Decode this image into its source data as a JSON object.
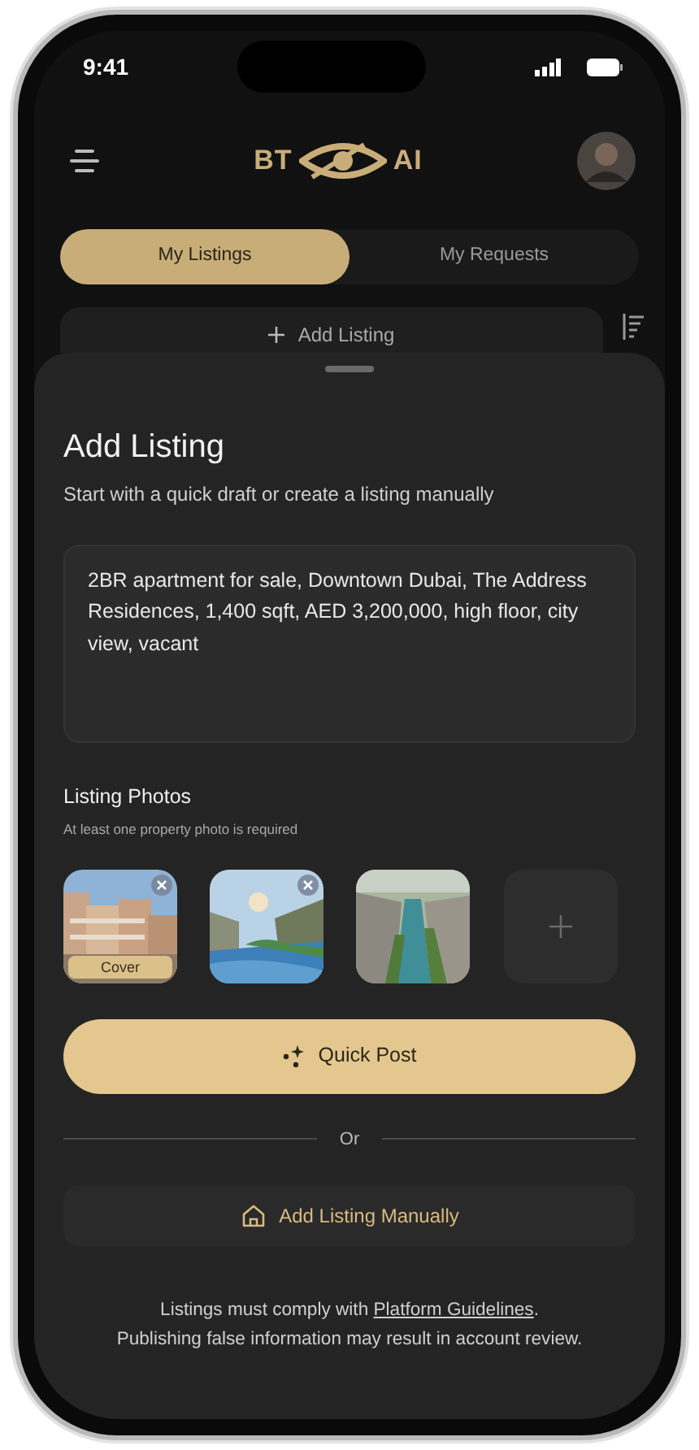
{
  "status_bar": {
    "time": "9:41"
  },
  "header": {
    "logo_left": "BT",
    "logo_right": "AI"
  },
  "tabs": [
    {
      "label": "My Listings",
      "selected": true
    },
    {
      "label": "My Requests",
      "selected": false
    }
  ],
  "add_listing_button": {
    "label": "Add Listing"
  },
  "sheet": {
    "title": "Add Listing",
    "subtitle": "Start with a quick draft or create a listing manually",
    "draft_text": "2BR apartment for sale, Downtown Dubai, The Address Residences, 1,400 sqft, AED 3,200,000, high floor, city view, vacant",
    "photos_title": "Listing Photos",
    "photos_hint": "At least one property photo is required",
    "photos": [
      {
        "kind": "picture",
        "removable": true,
        "badge": "Cover"
      },
      {
        "kind": "picture",
        "removable": true
      },
      {
        "kind": "picture",
        "removable": false
      }
    ],
    "quick_post": {
      "label": "Quick Post"
    },
    "divider_label": "Or",
    "manual_button": {
      "label": "Add Listing Manually"
    },
    "notice": {
      "before": "Listings must comply with ",
      "link": "Platform Guidelines",
      "after": ".",
      "line2": "Publishing false information may result in account review."
    }
  }
}
